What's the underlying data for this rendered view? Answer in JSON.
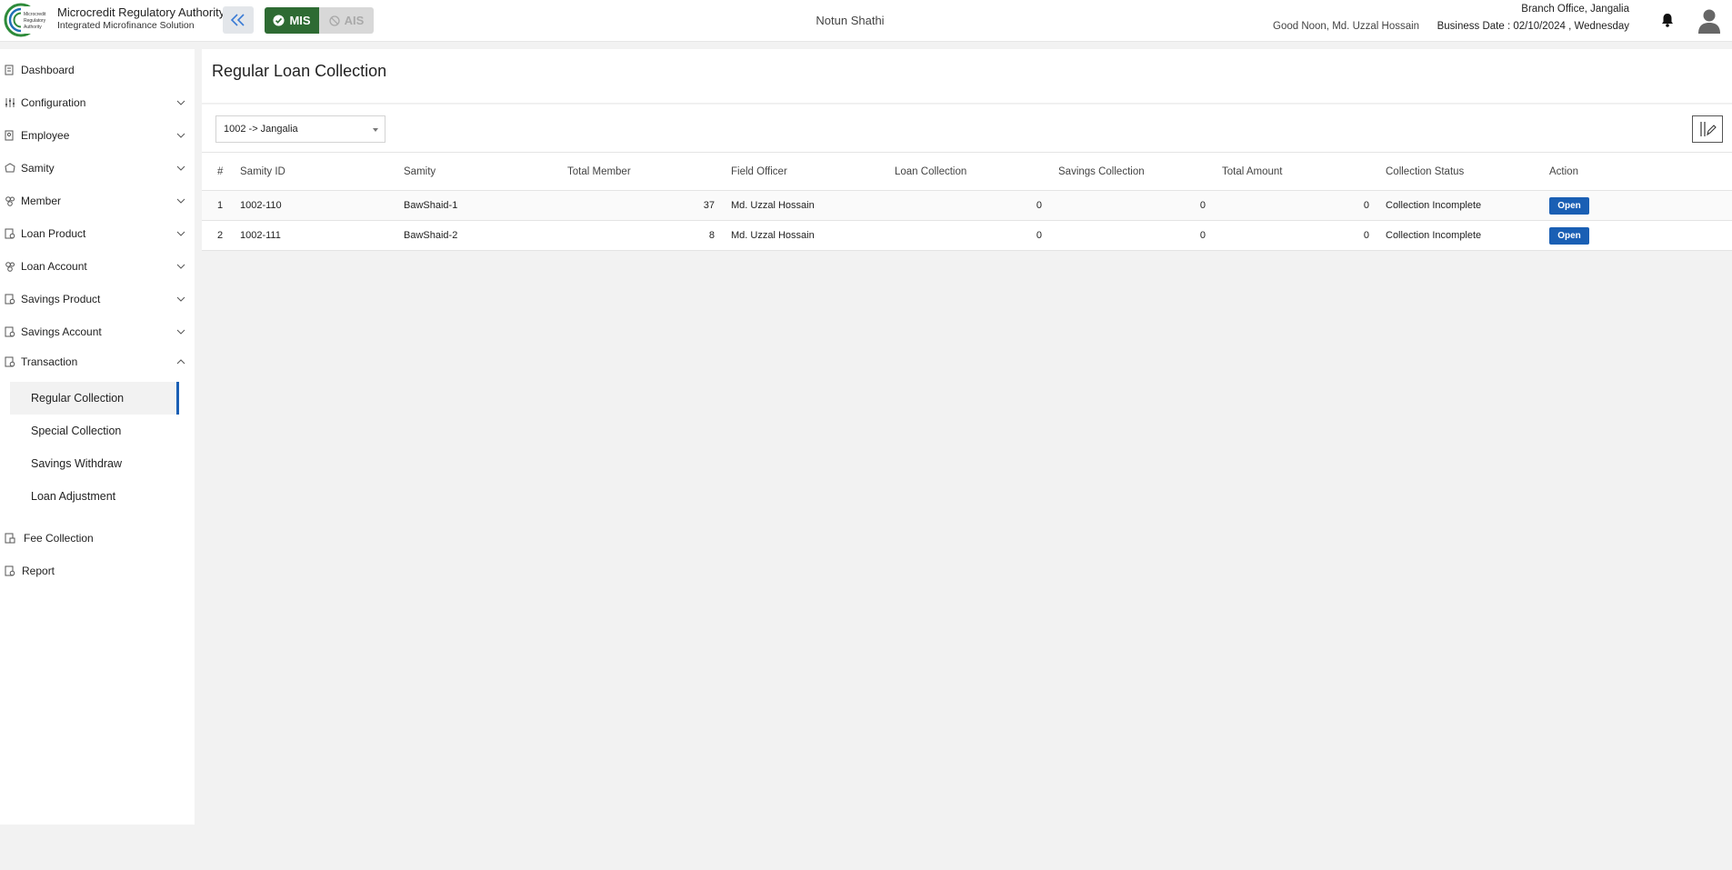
{
  "header": {
    "brand_title": "Microcredit Regulatory Authority",
    "brand_subtitle": "Integrated Microfinance Solution",
    "logo_text": "Microcredit Regulatory Authority",
    "mode_mis": "MIS",
    "mode_ais": "AIS",
    "org_name": "Notun Shathi",
    "branch": "Branch Office, Jangalia",
    "greeting": "Good Noon, Md. Uzzal Hossain",
    "business_date": "Business Date : 02/10/2024 , Wednesday",
    "accent_green": "#2e6b33",
    "accent_blue": "#1a5fb4"
  },
  "sidebar": {
    "items": [
      {
        "label": "Dashboard",
        "icon": "dashboard-icon",
        "expandable": false
      },
      {
        "label": "Configuration",
        "icon": "sliders-icon",
        "expandable": true
      },
      {
        "label": "Employee",
        "icon": "employee-icon",
        "expandable": true
      },
      {
        "label": "Samity",
        "icon": "samity-icon",
        "expandable": true
      },
      {
        "label": "Member",
        "icon": "member-icon",
        "expandable": true
      },
      {
        "label": "Loan Product",
        "icon": "loan-product-icon",
        "expandable": true
      },
      {
        "label": "Loan Account",
        "icon": "loan-account-icon",
        "expandable": true
      },
      {
        "label": "Savings Product",
        "icon": "savings-product-icon",
        "expandable": true
      },
      {
        "label": "Savings Account",
        "icon": "savings-account-icon",
        "expandable": true
      },
      {
        "label": "Transaction",
        "icon": "transaction-icon",
        "expandable": true,
        "expanded": true
      },
      {
        "label": "Fee Collection",
        "icon": "fee-collection-icon",
        "expandable": false
      },
      {
        "label": "Report",
        "icon": "report-icon",
        "expandable": false
      }
    ],
    "transaction_sub": [
      {
        "label": "Regular Collection",
        "active": true
      },
      {
        "label": "Special Collection",
        "active": false
      },
      {
        "label": "Savings Withdraw",
        "active": false
      },
      {
        "label": "Loan Adjustment",
        "active": false
      }
    ]
  },
  "main": {
    "title": "Regular Loan Collection",
    "branch_select": "1002 -> Jangalia",
    "table": {
      "headers": [
        "#",
        "Samity ID",
        "Samity",
        "Total Member",
        "Field Officer",
        "Loan Collection",
        "Savings Collection",
        "Total Amount",
        "Collection Status",
        "Action"
      ],
      "rows": [
        {
          "n": "1",
          "samity_id": "1002-110",
          "samity": "BawShaid-1",
          "total_member": "37",
          "field_officer": "Md. Uzzal Hossain",
          "loan_collection": "0",
          "savings_collection": "0",
          "total_amount": "0",
          "status": "Collection Incomplete",
          "action": "Open"
        },
        {
          "n": "2",
          "samity_id": "1002-111",
          "samity": "BawShaid-2",
          "total_member": "8",
          "field_officer": "Md. Uzzal Hossain",
          "loan_collection": "0",
          "savings_collection": "0",
          "total_amount": "0",
          "status": "Collection Incomplete",
          "action": "Open"
        }
      ]
    }
  }
}
